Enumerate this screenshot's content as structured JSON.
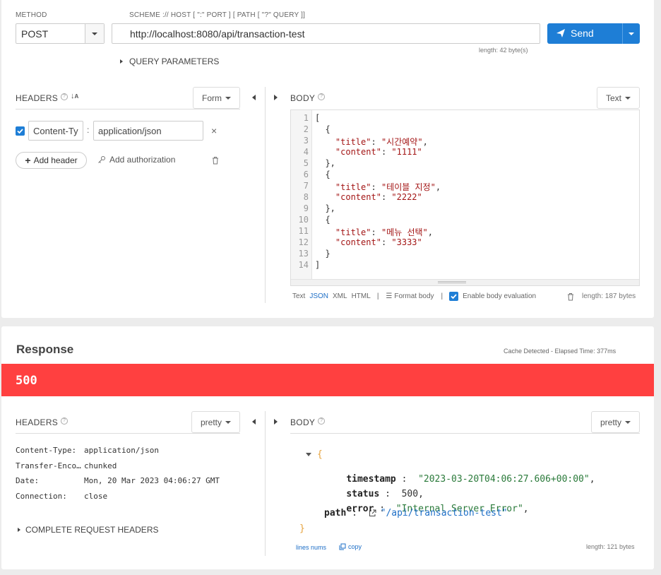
{
  "request": {
    "method_label": "METHOD",
    "method_value": "POST",
    "scheme_label": "SCHEME :// HOST [ \":\" PORT ] [ PATH [ \"?\" QUERY ]]",
    "url": "http://localhost:8080/api/transaction-test",
    "url_length": "length: 42 byte(s)",
    "send_label": "Send",
    "query_params_label": "QUERY PARAMETERS",
    "headers_title": "HEADERS",
    "headers_mode": "Form",
    "header_rows": [
      {
        "name": "Content-Ty",
        "sep": ":",
        "value": "application/json"
      }
    ],
    "add_header_label": "Add header",
    "add_auth_label": "Add authorization",
    "body_title": "BODY",
    "body_mode": "Text",
    "body_lines": [
      [
        "1",
        "["
      ],
      [
        "2",
        "  {"
      ],
      [
        "3",
        "    \"title\": \"시간예약\","
      ],
      [
        "4",
        "    \"content\": \"1111\""
      ],
      [
        "5",
        "  },"
      ],
      [
        "6",
        "  {"
      ],
      [
        "7",
        "    \"title\": \"테이블 지정\","
      ],
      [
        "8",
        "    \"content\": \"2222\""
      ],
      [
        "9",
        "  },"
      ],
      [
        "10",
        "  {"
      ],
      [
        "11",
        "    \"title\": \"메뉴 선택\","
      ],
      [
        "12",
        "    \"content\": \"3333\""
      ],
      [
        "13",
        "  }"
      ],
      [
        "14",
        "]"
      ]
    ],
    "footer_text": "Text",
    "footer_json": "JSON",
    "footer_xml": "XML",
    "footer_html": "HTML",
    "footer_sep": "|",
    "format_body": "Format body",
    "enable_eval": "Enable body evaluation",
    "body_length": "length: 187 bytes"
  },
  "response": {
    "title": "Response",
    "cache_info": "Cache Detected - Elapsed Time: 377ms",
    "status_code": "500",
    "status_color": "#ff4040",
    "headers_title": "HEADERS",
    "headers_mode": "pretty",
    "headers": [
      {
        "name": "Content-Type:",
        "value": "application/json"
      },
      {
        "name": "Transfer-Enco…",
        "value": "chunked"
      },
      {
        "name": "Date:",
        "value": "Mon, 20 Mar 2023 04:06:27 GMT"
      },
      {
        "name": "Connection:",
        "value": "close"
      }
    ],
    "complete_headers_label": "COMPLETE REQUEST HEADERS",
    "body_title": "BODY",
    "body_mode": "pretty",
    "open_brace": "{",
    "close_brace": "}",
    "fields": [
      {
        "key": "timestamp",
        "colon": ":",
        "value": "\"2023-03-20T04:06:27.606+00:00\"",
        "suffix": ","
      },
      {
        "key": "status",
        "colon": ":",
        "value": "500",
        "suffix": ","
      },
      {
        "key": "error",
        "colon": ":",
        "value": "\"Internal Server Error\"",
        "suffix": ","
      },
      {
        "key": "path",
        "colon": ":",
        "value": "\"/api/transaction-test\"",
        "suffix": ""
      }
    ],
    "lines_nums": "lines nums",
    "copy": "copy",
    "body_length": "length: 121 bytes"
  },
  "colors": {
    "accent": "#1e7ed6",
    "error": "#ff4040",
    "link": "#1e6fc7"
  }
}
